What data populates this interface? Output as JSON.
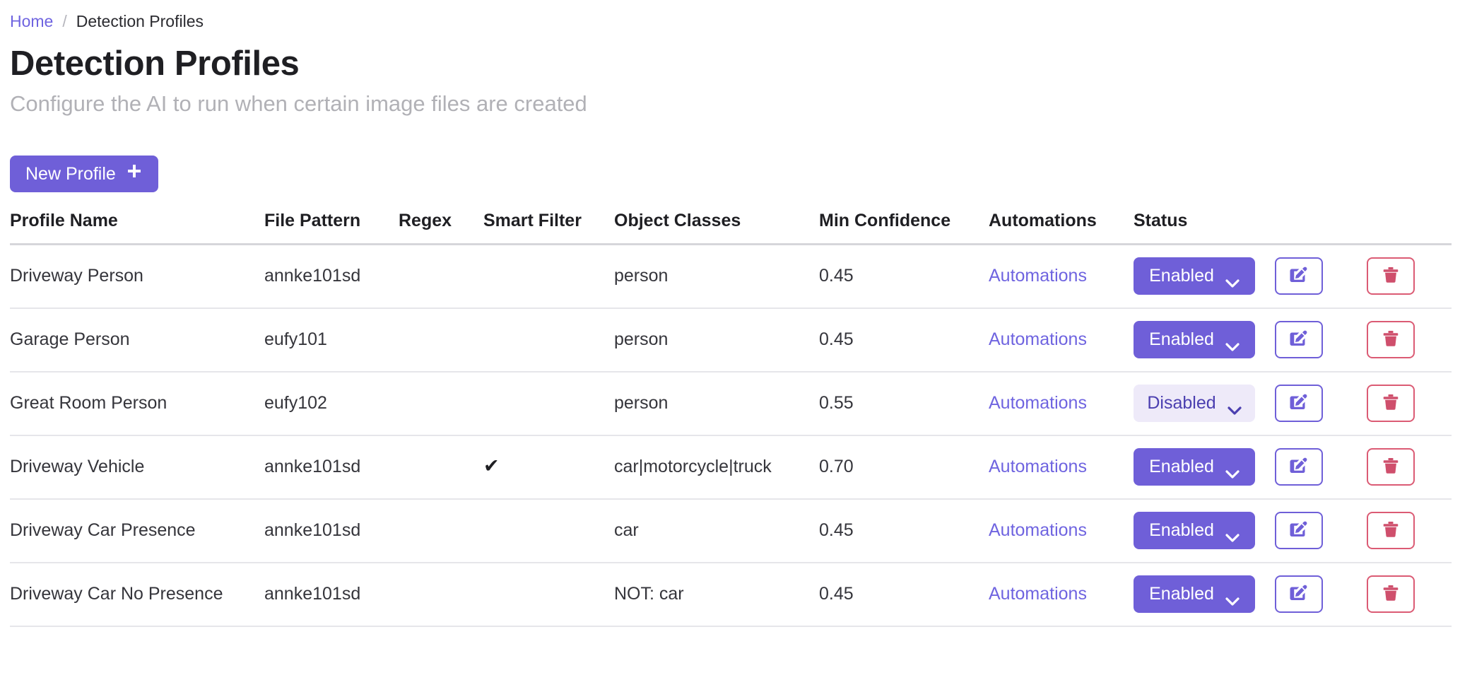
{
  "breadcrumb": {
    "home_label": "Home",
    "separator": "/",
    "current_label": "Detection Profiles"
  },
  "header": {
    "title": "Detection Profiles",
    "subtitle": "Configure the AI to run when certain image files are created"
  },
  "toolbar": {
    "new_profile_label": "New Profile",
    "new_profile_icon": "plus-icon",
    "plus_glyph": "＋"
  },
  "table": {
    "columns": [
      "Profile Name",
      "File Pattern",
      "Regex",
      "Smart Filter",
      "Object Classes",
      "Min Confidence",
      "Automations",
      "Status"
    ],
    "automations_link_label": "Automations",
    "check_glyph": "✔",
    "rows": [
      {
        "name": "Driveway Person",
        "file_pattern": "annke101sd",
        "regex": "",
        "smart_filter": "",
        "object_classes": "person",
        "min_confidence": "0.45",
        "automations": "Automations",
        "status": "Enabled",
        "status_state": "enabled"
      },
      {
        "name": "Garage Person",
        "file_pattern": "eufy101",
        "regex": "",
        "smart_filter": "",
        "object_classes": "person",
        "min_confidence": "0.45",
        "automations": "Automations",
        "status": "Enabled",
        "status_state": "enabled"
      },
      {
        "name": "Great Room Person",
        "file_pattern": "eufy102",
        "regex": "",
        "smart_filter": "",
        "object_classes": "person",
        "min_confidence": "0.55",
        "automations": "Automations",
        "status": "Disabled",
        "status_state": "disabled"
      },
      {
        "name": "Driveway Vehicle",
        "file_pattern": "annke101sd",
        "regex": "",
        "smart_filter": "✔",
        "object_classes": "car|motorcycle|truck",
        "min_confidence": "0.70",
        "automations": "Automations",
        "status": "Enabled",
        "status_state": "enabled"
      },
      {
        "name": "Driveway Car Presence",
        "file_pattern": "annke101sd",
        "regex": "",
        "smart_filter": "",
        "object_classes": "car",
        "min_confidence": "0.45",
        "automations": "Automations",
        "status": "Enabled",
        "status_state": "enabled"
      },
      {
        "name": "Driveway Car No Presence",
        "file_pattern": "annke101sd",
        "regex": "",
        "smart_filter": "",
        "object_classes": "NOT: car",
        "min_confidence": "0.45",
        "automations": "Automations",
        "status": "Enabled",
        "status_state": "enabled"
      }
    ],
    "row_actions": {
      "edit_icon": "pencil-square-icon",
      "delete_icon": "trash-icon"
    }
  },
  "colors": {
    "accent_purple": "#6f5fd8",
    "link_purple": "#6f64e0",
    "disabled_bg": "#eeeaf9",
    "disabled_text": "#4b3fb0",
    "danger_red": "#db5b74",
    "subtitle_gray": "#b1b1b6",
    "header_border": "#d6d6da",
    "row_border": "#e6e6ea"
  }
}
